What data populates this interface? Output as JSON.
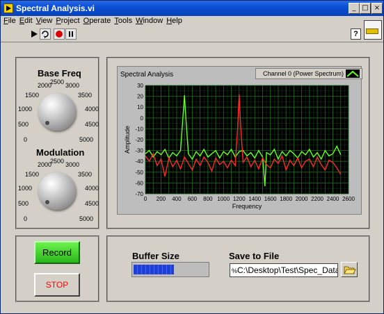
{
  "window": {
    "title": "Spectral Analysis.vi"
  },
  "menu": [
    "File",
    "Edit",
    "View",
    "Project",
    "Operate",
    "Tools",
    "Window",
    "Help"
  ],
  "toolbar": {
    "help_label": "?"
  },
  "knobs": [
    {
      "label": "Base Freq",
      "ticks": [
        "0",
        "500",
        "1000",
        "1500",
        "2000",
        "2500",
        "3000",
        "3500",
        "4000",
        "4500",
        "5000"
      ],
      "value": 500
    },
    {
      "label": "Modulation",
      "ticks": [
        "0",
        "500",
        "1000",
        "1500",
        "2000",
        "2500",
        "3000",
        "3500",
        "4000",
        "4500",
        "5000"
      ],
      "value": 500
    }
  ],
  "graph": {
    "title": "Spectral Analysis",
    "legend": "Channel 0 (Power Spectrum)",
    "colors": {
      "green": "#66ff22",
      "red": "#ff2a2a",
      "plot_bg": "#000000",
      "grid": "#1f6b1f"
    }
  },
  "chart_data": {
    "type": "line",
    "title": "Spectral Analysis",
    "xlabel": "Frequency",
    "ylabel": "Amplitude",
    "xlim": [
      0,
      2600
    ],
    "ylim": [
      -70,
      30
    ],
    "xticks": [
      "0",
      "100",
      "200",
      "300",
      "400",
      "500",
      "600",
      "700",
      "800",
      "900",
      "1000",
      "1100",
      "1200",
      "1300",
      "1400",
      "1500",
      "1600",
      "1700",
      "1800",
      "1900",
      "2000",
      "2100",
      "2200",
      "2300",
      "2400",
      "2500",
      "2600"
    ],
    "yticks": [
      "30",
      "20",
      "10",
      "0",
      "-10",
      "-20",
      "-30",
      "-40",
      "-50",
      "-60",
      "-70"
    ],
    "series": [
      {
        "name": "Channel 0 (Power Spectrum)",
        "color": "#66ff22",
        "x": [
          0,
          50,
          100,
          150,
          200,
          250,
          300,
          350,
          400,
          450,
          480,
          500,
          520,
          550,
          600,
          650,
          700,
          750,
          800,
          850,
          900,
          950,
          1000,
          1050,
          1100,
          1150,
          1200,
          1250,
          1300,
          1350,
          1400,
          1450,
          1500,
          1530,
          1550,
          1600,
          1650,
          1700,
          1750,
          1800,
          1850,
          1900,
          1950,
          2000,
          2050,
          2100,
          2150,
          2200,
          2250,
          2300,
          2350,
          2400,
          2450,
          2500
        ],
        "y": [
          -33,
          -30,
          -36,
          -31,
          -34,
          -29,
          -37,
          -32,
          -35,
          -30,
          0,
          21,
          -2,
          -33,
          -38,
          -31,
          -35,
          -29,
          -36,
          -33,
          -30,
          -37,
          -31,
          -34,
          -29,
          -36,
          -31,
          -30,
          -35,
          -32,
          -37,
          -30,
          -36,
          -63,
          -32,
          -34,
          -29,
          -38,
          -31,
          -35,
          -30,
          -33,
          -37,
          -31,
          -34,
          -29,
          -36,
          -32,
          -38,
          -30,
          -35,
          -33,
          -26,
          -34
        ]
      },
      {
        "name": "",
        "color": "#ff2a2a",
        "x": [
          0,
          50,
          100,
          150,
          200,
          250,
          300,
          350,
          400,
          450,
          500,
          550,
          600,
          650,
          700,
          750,
          800,
          850,
          900,
          950,
          1000,
          1050,
          1100,
          1150,
          1180,
          1200,
          1220,
          1250,
          1300,
          1350,
          1400,
          1450,
          1500,
          1550,
          1600,
          1650,
          1700,
          1750,
          1800,
          1850,
          1900,
          1950,
          2000,
          2050,
          2100,
          2150,
          2200,
          2250,
          2300,
          2350,
          2400,
          2450,
          2500
        ],
        "y": [
          -35,
          -40,
          -33,
          -44,
          -38,
          -54,
          -37,
          -45,
          -39,
          -47,
          -36,
          -42,
          -48,
          -38,
          -44,
          -36,
          -41,
          -49,
          -37,
          -43,
          -40,
          -46,
          -39,
          -44,
          -10,
          22,
          -8,
          -41,
          -36,
          -45,
          -39,
          -47,
          -37,
          -43,
          -46,
          -38,
          -42,
          -35,
          -48,
          -39,
          -44,
          -37,
          -46,
          -40,
          -38,
          -45,
          -36,
          -43,
          -48,
          -39,
          -41,
          -46,
          -52
        ]
      }
    ]
  },
  "controls": {
    "record_label": "Record",
    "stop_label": "STOP",
    "buffer_label": "Buffer Size",
    "buffer_fill": 0.55,
    "save_label": "Save to File",
    "save_path": "C:\\Desktop\\Test\\Spec_Data",
    "path_prefix": "%"
  }
}
